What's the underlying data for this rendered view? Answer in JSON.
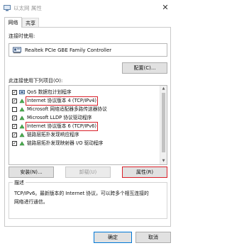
{
  "window": {
    "title": "以太网 属性",
    "close_glyph": "✕"
  },
  "tabs": [
    {
      "label": "网络"
    },
    {
      "label": "共享"
    }
  ],
  "connect_using": {
    "label": "连接时使用:",
    "adapter": "Realtek PCIe GBE Family Controller",
    "configure_button": "配置(C)..."
  },
  "items_label": "此连接使用下列项目(O):",
  "items": [
    {
      "label": "QoS 数据包计划程序",
      "checked": true
    },
    {
      "label": "Internet 协议版本 4 (TCP/IPv4)",
      "checked": true
    },
    {
      "label": "Microsoft 网络适配器多路传送器协议",
      "checked": false
    },
    {
      "label": "Microsoft LLDP 协议驱动程序",
      "checked": true
    },
    {
      "label": "Internet 协议版本 6 (TCP/IPv6)",
      "checked": true
    },
    {
      "label": "链路层拓扑发现响应程序",
      "checked": true
    },
    {
      "label": "链路层拓扑发现映射器 I/O 驱动程序",
      "checked": true
    }
  ],
  "buttons": {
    "install": "安装(N)...",
    "uninstall": "卸载(U)",
    "properties": "属性(R)",
    "ok": "确定",
    "cancel": "取消"
  },
  "description": {
    "legend": "描述",
    "line1": "TCP/IPv6。最新版本的 Internet 协议，可以跨多个相互连接的",
    "line2": "网络进行通信。"
  },
  "colors": {
    "highlight_border": "#d9202a",
    "accent": "#0078d7"
  }
}
